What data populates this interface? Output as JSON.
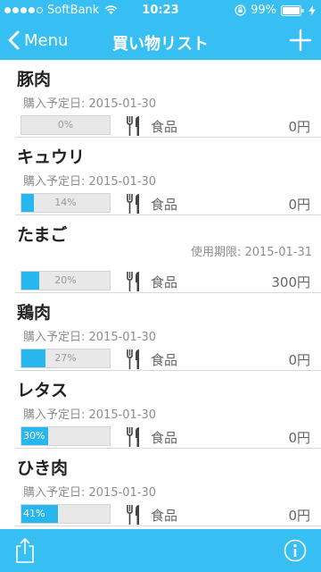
{
  "status": {
    "carrier": "SoftBank",
    "time": "10:23",
    "battery": "99%"
  },
  "nav": {
    "back_label": "Menu",
    "title": "買い物リスト"
  },
  "colors": {
    "accent": "#37bff4",
    "progress": "#27b6ee"
  },
  "items": [
    {
      "name": "豚肉",
      "date_label": "購入予定日: 2015-01-30",
      "date_align": "left",
      "progress": 0,
      "progress_label": "0%",
      "category": "食品",
      "price": "0円"
    },
    {
      "name": "キュウリ",
      "date_label": "購入予定日: 2015-01-30",
      "date_align": "left",
      "progress": 14,
      "progress_label": "14%",
      "category": "食品",
      "price": "0円"
    },
    {
      "name": "たまご",
      "date_label": "使用期限: 2015-01-31",
      "date_align": "right",
      "progress": 20,
      "progress_label": "20%",
      "category": "食品",
      "price": "300円"
    },
    {
      "name": "鶏肉",
      "date_label": "購入予定日: 2015-01-30",
      "date_align": "left",
      "progress": 27,
      "progress_label": "27%",
      "category": "食品",
      "price": "0円"
    },
    {
      "name": "レタス",
      "date_label": "購入予定日: 2015-01-30",
      "date_align": "left",
      "progress": 30,
      "progress_label": "30%",
      "category": "食品",
      "price": "0円"
    },
    {
      "name": "ひき肉",
      "date_label": "購入予定日: 2015-01-30",
      "date_align": "left",
      "progress": 41,
      "progress_label": "41%",
      "category": "食品",
      "price": "0円"
    }
  ],
  "icons": {
    "category": "fork-knife-icon",
    "share": "share-icon",
    "info": "info-icon",
    "add": "plus-icon",
    "back": "chevron-left-icon"
  }
}
